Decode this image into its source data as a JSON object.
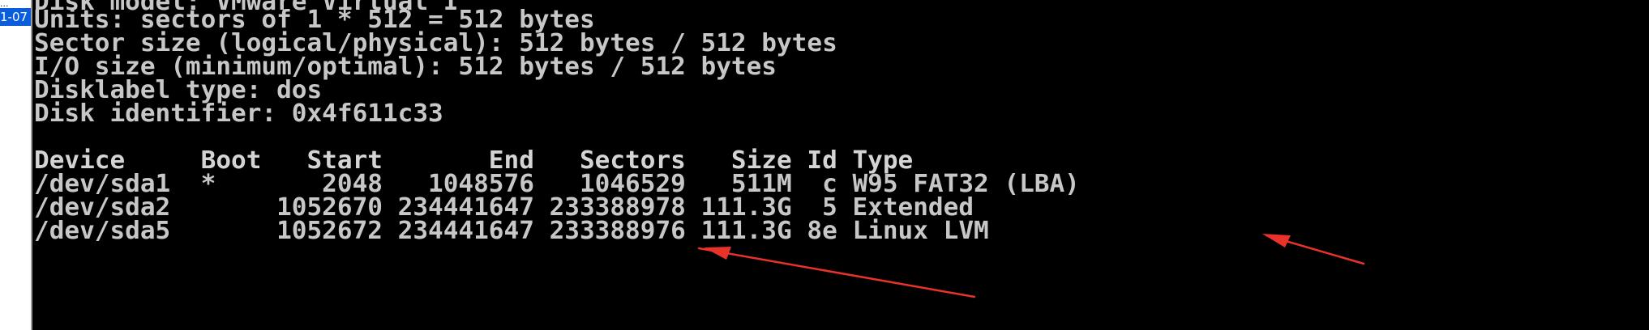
{
  "sidebar": {
    "top_text": "...",
    "label": "1-07"
  },
  "terminal": {
    "lines": [
      "Disk model: VMware Virtual I",
      "Units: sectors of 1 * 512 = 512 bytes",
      "Sector size (logical/physical): 512 bytes / 512 bytes",
      "I/O size (minimum/optimal): 512 bytes / 512 bytes",
      "Disklabel type: dos",
      "Disk identifier: 0x4f611c33",
      "",
      "Device     Boot   Start       End   Sectors   Size Id Type",
      "/dev/sda1  *       2048   1048576   1046529   511M  c W95 FAT32 (LBA)",
      "/dev/sda2       1052670 234441647 233388978 111.3G  5 Extended",
      "/dev/sda5       1052672 234441647 233388976 111.3G 8e Linux LVM"
    ]
  },
  "colors": {
    "terminal_bg": "#000000",
    "terminal_text": "#c7c7c7",
    "annotation_arrow": "#e8322a",
    "sidebar_highlight": "#0a5ddb"
  },
  "icons": [
    "red-annotation-arrow"
  ]
}
